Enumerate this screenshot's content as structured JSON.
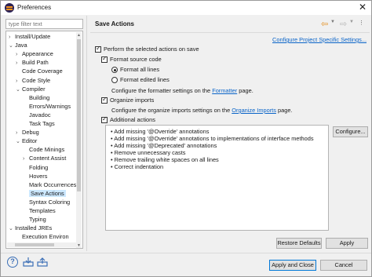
{
  "window": {
    "title": "Preferences",
    "close_glyph": "✕"
  },
  "filter": {
    "placeholder": "type filter text"
  },
  "tree": {
    "items": [
      {
        "label": "Install/Update",
        "toggle": "›"
      },
      {
        "label": "Java",
        "toggle": "⌄"
      },
      {
        "label": "Appearance",
        "toggle": "›"
      },
      {
        "label": "Build Path",
        "toggle": "›"
      },
      {
        "label": "Code Coverage",
        "toggle": ""
      },
      {
        "label": "Code Style",
        "toggle": "›"
      },
      {
        "label": "Compiler",
        "toggle": "⌄"
      },
      {
        "label": "Building",
        "toggle": ""
      },
      {
        "label": "Errors/Warnings",
        "toggle": ""
      },
      {
        "label": "Javadoc",
        "toggle": ""
      },
      {
        "label": "Task Tags",
        "toggle": ""
      },
      {
        "label": "Debug",
        "toggle": "›"
      },
      {
        "label": "Editor",
        "toggle": "⌄"
      },
      {
        "label": "Code Minings",
        "toggle": ""
      },
      {
        "label": "Content Assist",
        "toggle": "›"
      },
      {
        "label": "Folding",
        "toggle": ""
      },
      {
        "label": "Hovers",
        "toggle": ""
      },
      {
        "label": "Mark Occurrences",
        "toggle": ""
      },
      {
        "label": "Save Actions",
        "toggle": "",
        "selected": true
      },
      {
        "label": "Syntax Coloring",
        "toggle": ""
      },
      {
        "label": "Templates",
        "toggle": ""
      },
      {
        "label": "Typing",
        "toggle": ""
      },
      {
        "label": "Installed JREs",
        "toggle": "⌄"
      },
      {
        "label": "Execution Environ",
        "toggle": ""
      }
    ]
  },
  "header": {
    "title": "Save Actions",
    "configure_link": "Configure Project Specific Settings..."
  },
  "options": {
    "perform_actions": {
      "label": "Perform the selected actions on save",
      "checked": true
    },
    "format_source": {
      "label": "Format source code",
      "checked": true
    },
    "format_all": {
      "label": "Format all lines",
      "selected": true
    },
    "format_edited": {
      "label": "Format edited lines",
      "selected": false
    },
    "formatter_note_pre": "Configure the formatter settings on the ",
    "formatter_link": "Formatter",
    "formatter_note_post": " page.",
    "organize_imports": {
      "label": "Organize imports",
      "checked": true
    },
    "imports_note_pre": "Configure the organize imports settings on the ",
    "imports_link": "Organize Imports",
    "imports_note_post": " page.",
    "additional_actions": {
      "label": "Additional actions",
      "checked": true
    }
  },
  "additional_list": [
    "Add missing '@Override' annotations",
    "Add missing '@Override' annotations to implementations of interface methods",
    "Add missing '@Deprecated' annotations",
    "Remove unnecessary casts",
    "Remove trailing white spaces on all lines",
    "Correct indentation"
  ],
  "buttons": {
    "configure": "Configure...",
    "restore_defaults": "Restore Defaults",
    "apply": "Apply",
    "apply_and_close": "Apply and Close",
    "cancel": "Cancel"
  },
  "footer": {
    "help_glyph": "?"
  }
}
